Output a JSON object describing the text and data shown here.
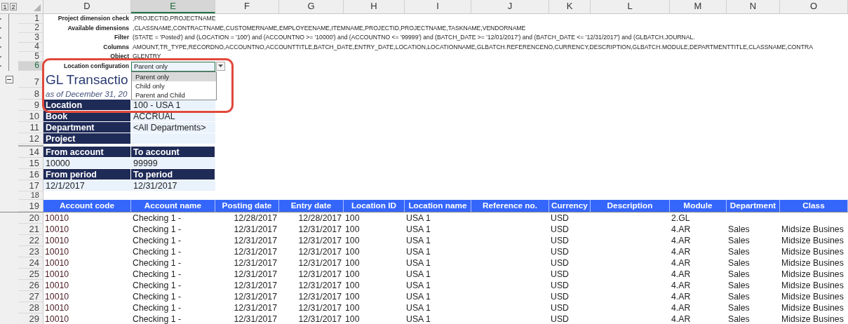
{
  "outline_levels": [
    "1",
    "2"
  ],
  "columns": [
    {
      "label": "D",
      "selected": false
    },
    {
      "label": "E",
      "selected": true
    },
    {
      "label": "F",
      "selected": false
    },
    {
      "label": "G",
      "selected": false
    },
    {
      "label": "H",
      "selected": false
    },
    {
      "label": "I",
      "selected": false
    },
    {
      "label": "J",
      "selected": false
    },
    {
      "label": "K",
      "selected": false
    },
    {
      "label": "L",
      "selected": false
    },
    {
      "label": "M",
      "selected": false
    },
    {
      "label": "N",
      "selected": false
    },
    {
      "label": "O",
      "selected": false
    }
  ],
  "params": [
    {
      "row": "1",
      "label": "Project dimension check",
      "value": ",PROJECTID,PROJECTNAME"
    },
    {
      "row": "2",
      "label": "Available dimensions",
      "value": ",CLASSNAME,CONTRACTNAME,CUSTOMERNAME,EMPLOYEENAME,ITEMNAME,PROJECTID,PROJECTNAME,TASKNAME,VENDORNAME"
    },
    {
      "row": "3",
      "label": "Filter",
      "value": "(STATE = 'Posted') and (LOCATION = '100') and (ACCOUNTNO >= '10000') and (ACCOUNTNO <= '99999') and (BATCH_DATE >= '12/01/2017') and (BATCH_DATE <= '12/31/2017') and (GLBATCH.JOURNAL."
    },
    {
      "row": "4",
      "label": "Columns",
      "value": "AMOUNT,TR_TYPE,RECORDNO,ACCOUNTNO,ACCOUNTTITLE,BATCH_DATE,ENTRY_DATE,LOCATION,LOCATIONNAME,GLBATCH.REFERENCENO,CURRENCY,DESCRIPTION,GLBATCH.MODULE,DEPARTMENTTITLE,CLASSNAME,CONTRA"
    },
    {
      "row": "5",
      "label": "Object",
      "value": "GLENTRY"
    }
  ],
  "location_config": {
    "row": "6",
    "selected": true,
    "label": "Location configuration",
    "value": "Parent only",
    "expanded": true,
    "options": [
      {
        "label": "Parent only",
        "selected": true
      },
      {
        "label": "Child only",
        "selected": false
      },
      {
        "label": "Parent and Child",
        "selected": false
      }
    ]
  },
  "title": {
    "row": "7",
    "text": "GL Transactio"
  },
  "subtitle": {
    "row": "8",
    "text": "as of December 31, 20"
  },
  "filters": [
    {
      "row": "9",
      "label": "Location",
      "value": "100 - USA 1"
    },
    {
      "row": "10",
      "label": "Book",
      "value": "ACCRUAL"
    },
    {
      "row": "11",
      "label": "Department",
      "value": "<All Departments>"
    },
    {
      "row": "12",
      "label": "Project"
    }
  ],
  "ranges": [
    {
      "row": "14",
      "kind": "header",
      "cells": [
        "From account",
        "To account"
      ]
    },
    {
      "row": "15",
      "kind": "value",
      "cells": [
        "10000",
        "99999"
      ]
    },
    {
      "row": "16",
      "kind": "header",
      "cells": [
        "From period",
        "To period"
      ]
    },
    {
      "row": "17",
      "kind": "value",
      "cells": [
        "12/1/2017",
        "12/31/2017"
      ]
    }
  ],
  "spacer_row": "18",
  "table": {
    "header_row": "19",
    "columns": [
      "Account code",
      "Account name",
      "Posting date",
      "Entry date",
      "Location ID",
      "Location name",
      "Reference no.",
      "Currency",
      "Description",
      "Module",
      "Department",
      "Class"
    ],
    "rows": [
      {
        "row": "20",
        "cells": [
          "10010",
          "Checking 1 -",
          "12/28/2017",
          "12/28/2017",
          "100",
          "USA 1",
          "",
          "USD",
          "",
          "2.GL",
          "",
          ""
        ]
      },
      {
        "row": "21",
        "cells": [
          "10010",
          "Checking 1 -",
          "12/31/2017",
          "12/31/2017",
          "100",
          "USA 1",
          "",
          "USD",
          "",
          "4.AR",
          "Sales",
          "Midsize Busines"
        ]
      },
      {
        "row": "22",
        "cells": [
          "10010",
          "Checking 1 -",
          "12/31/2017",
          "12/31/2017",
          "100",
          "USA 1",
          "",
          "USD",
          "",
          "4.AR",
          "Sales",
          "Midsize Busines"
        ]
      },
      {
        "row": "23",
        "cells": [
          "10010",
          "Checking 1 -",
          "12/31/2017",
          "12/31/2017",
          "100",
          "USA 1",
          "",
          "USD",
          "",
          "4.AR",
          "Sales",
          "Midsize Busines"
        ]
      },
      {
        "row": "24",
        "cells": [
          "10010",
          "Checking 1 -",
          "12/31/2017",
          "12/31/2017",
          "100",
          "USA 1",
          "",
          "USD",
          "",
          "4.AR",
          "Sales",
          "Midsize Busines"
        ]
      },
      {
        "row": "25",
        "cells": [
          "10010",
          "Checking 1 -",
          "12/31/2017",
          "12/31/2017",
          "100",
          "USA 1",
          "",
          "USD",
          "",
          "4.AR",
          "Sales",
          "Midsize Busines"
        ]
      },
      {
        "row": "26",
        "cells": [
          "10010",
          "Checking 1 -",
          "12/31/2017",
          "12/31/2017",
          "100",
          "USA 1",
          "",
          "USD",
          "",
          "4.AR",
          "Sales",
          "Midsize Busines"
        ]
      },
      {
        "row": "27",
        "cells": [
          "10010",
          "Checking 1 -",
          "12/31/2017",
          "12/31/2017",
          "100",
          "USA 1",
          "",
          "USD",
          "",
          "4.AR",
          "Sales",
          "Midsize Busines"
        ]
      },
      {
        "row": "28",
        "cells": [
          "10010",
          "Checking 1 -",
          "12/31/2017",
          "12/31/2017",
          "100",
          "USA 1",
          "",
          "USD",
          "",
          "4.AR",
          "Sales",
          "Midsize Busines"
        ]
      },
      {
        "row": "29",
        "cells": [
          "10010",
          "Checking 1 -",
          "12/31/2017",
          "12/31/2017",
          "100",
          "USA 1",
          "",
          "USD",
          "",
          "4.AR",
          "Sales",
          "Midsize Busines"
        ]
      }
    ]
  },
  "highlight": {
    "kind": "rounded-frame"
  }
}
